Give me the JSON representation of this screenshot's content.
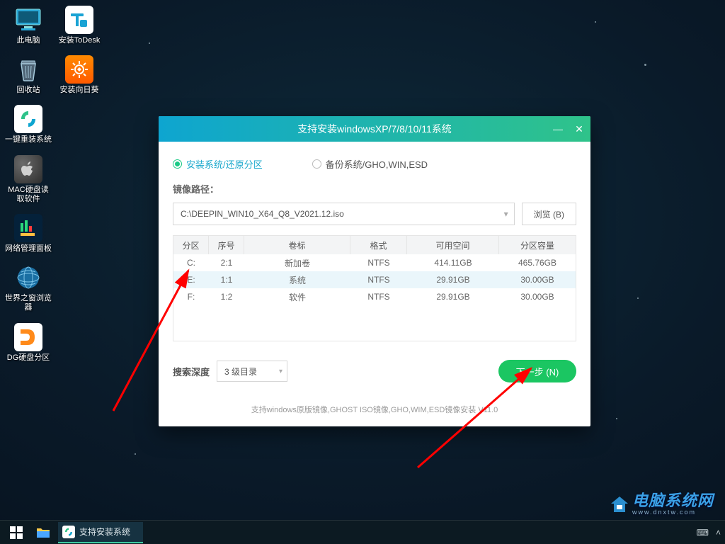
{
  "desktop_col1": [
    {
      "name": "pc",
      "label": "此电脑"
    },
    {
      "name": "recycle",
      "label": "回收站"
    },
    {
      "name": "reinstall",
      "label": "一键重装系统"
    },
    {
      "name": "mac",
      "label": "MAC硬盘读\n取软件",
      "wrap": true
    },
    {
      "name": "netpanel",
      "label": "网络管理面板"
    },
    {
      "name": "browser",
      "label": "世界之窗浏览\n器",
      "wrap": true
    },
    {
      "name": "dg",
      "label": "DG硬盘分区"
    }
  ],
  "desktop_col2": [
    {
      "name": "todesk",
      "label": "安装ToDesk"
    },
    {
      "name": "sunflower",
      "label": "安装向日葵"
    }
  ],
  "window": {
    "title": "支持安装windowsXP/7/8/10/11系统",
    "radio_install": "安装系统/还原分区",
    "radio_backup": "备份系统/GHO,WIN,ESD",
    "path_label": "镜像路径：",
    "path_value": "C:\\DEEPIN_WIN10_X64_Q8_V2021.12.iso",
    "browse": "浏览 (B)",
    "columns": [
      "分区",
      "序号",
      "卷标",
      "格式",
      "可用空间",
      "分区容量"
    ],
    "rows": [
      {
        "drive": "C:",
        "index": "2:1",
        "label": "新加卷",
        "fs": "NTFS",
        "free": "414.11GB",
        "size": "465.76GB"
      },
      {
        "drive": "E:",
        "index": "1:1",
        "label": "系统",
        "fs": "NTFS",
        "free": "29.91GB",
        "size": "30.00GB"
      },
      {
        "drive": "F:",
        "index": "1:2",
        "label": "软件",
        "fs": "NTFS",
        "free": "29.91GB",
        "size": "30.00GB"
      }
    ],
    "depth_label": "搜索深度",
    "depth_value": "3 级目录",
    "next": "下一步 (N)",
    "footer": "支持windows原版镜像,GHOST ISO镜像,GHO,WIM,ESD镜像安装 V11.0"
  },
  "taskbar": {
    "app_label": "支持安装系统"
  },
  "watermark": {
    "text": "电脑系统网",
    "sub": "www.dnxtw.com"
  }
}
